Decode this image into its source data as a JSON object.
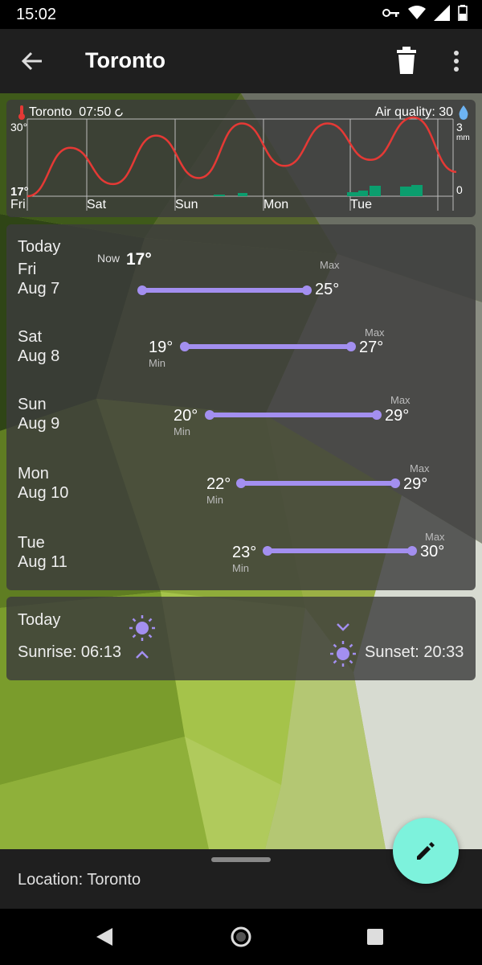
{
  "status_bar": {
    "time": "15:02",
    "icons": [
      "vpn-key-icon",
      "wifi-icon",
      "signal-icon",
      "battery-icon"
    ]
  },
  "app_bar": {
    "title": "Toronto",
    "icons": [
      "back-arrow-icon",
      "trash-icon",
      "more-vert-icon"
    ]
  },
  "chart": {
    "location_time": "Toronto  07:50",
    "air_quality": "Air quality: 30",
    "y_left_top": "30°",
    "y_left_bottom": "17°",
    "y_right_top": "3",
    "y_right_unit": "mm",
    "y_right_bottom": "0",
    "days": [
      "Fri",
      "Sat",
      "Sun",
      "Mon",
      "Tue"
    ],
    "temperature_color": "#e53935",
    "precip_color": "#0b9e6e"
  },
  "chart_data": {
    "type": "line",
    "title": "",
    "x": [
      "Fri",
      "Sat",
      "Sun",
      "Mon",
      "Tue"
    ],
    "series": [
      {
        "values": [
          17,
          25,
          19,
          27,
          20,
          29,
          22,
          29,
          23,
          30,
          21
        ]
      }
    ],
    "ylim": [
      17,
      30
    ],
    "ylabel_right": "mm",
    "precip_ylim": [
      0,
      3
    ]
  },
  "forecast": {
    "days": [
      {
        "label1": "Today",
        "label2": "Fri",
        "label3": "Aug 7",
        "now_label": "Now",
        "now_temp": "17°",
        "max_label": "Max",
        "max": "25°"
      },
      {
        "label1": "Sat",
        "label2": "Aug 8",
        "min": "19°",
        "min_label": "Min",
        "max_label": "Max",
        "max": "27°"
      },
      {
        "label1": "Sun",
        "label2": "Aug 9",
        "min": "20°",
        "min_label": "Min",
        "max_label": "Max",
        "max": "29°"
      },
      {
        "label1": "Mon",
        "label2": "Aug 10",
        "min": "22°",
        "min_label": "Min",
        "max_label": "Max",
        "max": "29°"
      },
      {
        "label1": "Tue",
        "label2": "Aug 11",
        "min": "23°",
        "min_label": "Min",
        "max_label": "Max",
        "max": "30°"
      }
    ],
    "bar_color": "#a38ff0"
  },
  "sun": {
    "title": "Today",
    "sunrise": "Sunrise: 06:13",
    "sunset": "Sunset: 20:33"
  },
  "bottom": {
    "location": "Location: Toronto"
  },
  "fab": {
    "icon": "edit-pencil-icon",
    "color": "#7df2dc"
  },
  "nav": {
    "icons": [
      "back-triangle-icon",
      "home-circle-icon",
      "recents-square-icon"
    ]
  }
}
